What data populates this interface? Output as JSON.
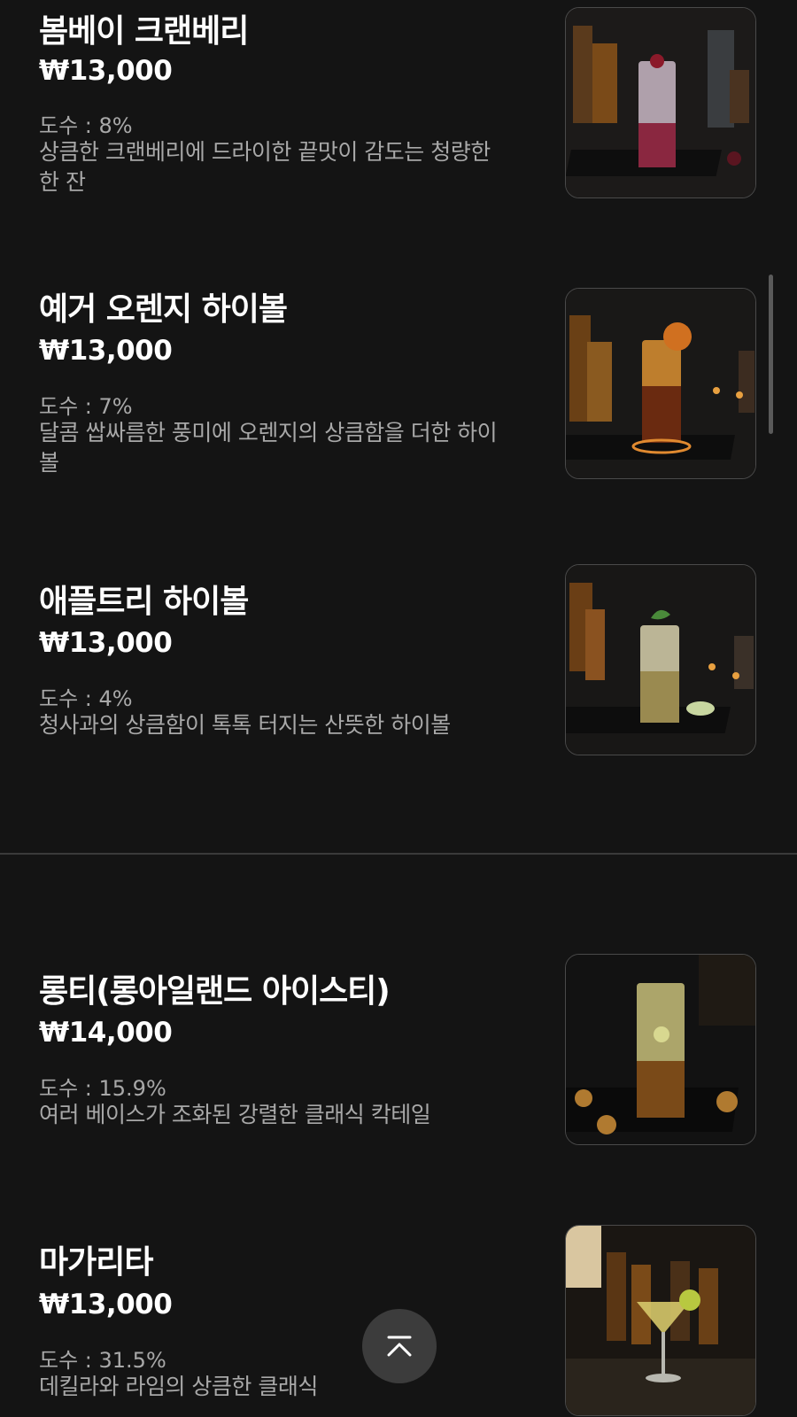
{
  "menu_items": [
    {
      "name": "봄베이 크랜베리",
      "price": "₩13,000",
      "abv": "도수 : 8%",
      "description": "상큼한 크랜베리에 드라이한 끝맛이 감도는 청량한 한 잔"
    },
    {
      "name": "예거 오렌지 하이볼",
      "price": "₩13,000",
      "abv": "도수 : 7%",
      "description": "달콤 쌉싸름한 풍미에 오렌지의 상큼함을 더한 하이볼"
    },
    {
      "name": "애플트리 하이볼",
      "price": "₩13,000",
      "abv": "도수 : 4%",
      "description": "청사과의 상큼함이 톡톡 터지는 산뜻한 하이볼"
    },
    {
      "name": "롱티(롱아일랜드 아이스티)",
      "price": "₩14,000",
      "abv": "도수 : 15.9%",
      "description": "여러 베이스가 조화된 강렬한 클래식 칵테일"
    },
    {
      "name": "마가리타",
      "price": "₩13,000",
      "abv": "도수 : 31.5%",
      "description": "데킬라와 라임의 상큼한 클래식"
    }
  ],
  "colors": {
    "background": "#141414",
    "text_primary": "#ffffff",
    "text_secondary": "#a8a8a8",
    "divider": "#3a3a3a",
    "scroll_top_button": "#3c3c3c"
  },
  "icons": {
    "scroll_top": "chevron-up-icon"
  }
}
